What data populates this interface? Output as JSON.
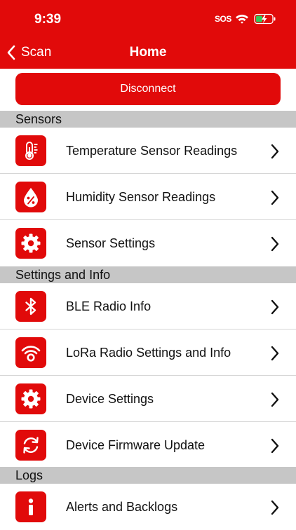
{
  "status_bar": {
    "time": "9:39",
    "sos": "SOS"
  },
  "nav": {
    "back_label": "Scan",
    "title": "Home"
  },
  "disconnect_label": "Disconnect",
  "sections": [
    {
      "title": "Sensors"
    },
    {
      "title": "Settings and Info"
    },
    {
      "title": "Logs"
    }
  ],
  "rows": [
    {
      "label": "Temperature Sensor Readings",
      "icon": "thermometer-icon"
    },
    {
      "label": "Humidity Sensor Readings",
      "icon": "humidity-drop-icon"
    },
    {
      "label": "Sensor Settings",
      "icon": "gear-icon"
    },
    {
      "label": "BLE Radio Info",
      "icon": "bluetooth-icon"
    },
    {
      "label": "LoRa Radio Settings and Info",
      "icon": "radio-signal-icon"
    },
    {
      "label": "Device Settings",
      "icon": "gear-icon"
    },
    {
      "label": "Device Firmware Update",
      "icon": "sync-icon"
    },
    {
      "label": "Alerts and Backlogs",
      "icon": "info-icon"
    }
  ],
  "colors": {
    "brand_red": "#e10a0a",
    "section_gray": "#c6c6c6",
    "battery_green": "#34c759"
  }
}
